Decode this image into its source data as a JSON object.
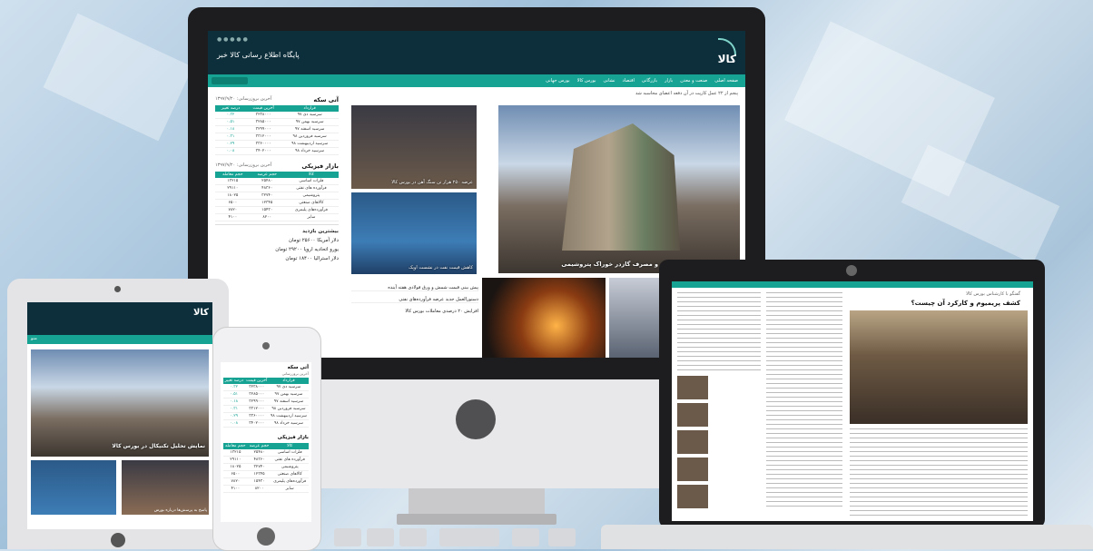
{
  "site": {
    "title": "پایگاه اطلاع رسانی کالا خبر",
    "logo_text": "کالا",
    "accent": "#16a394",
    "header_bg": "#0c2f3b"
  },
  "nav": {
    "items": [
      "صفحه اصلی",
      "صنعت و معدن",
      "بازار",
      "بازرگانی",
      "اقتصاد",
      "نشانی",
      "بورس کالا",
      "بورس جهانی"
    ]
  },
  "breadcrumb": "پنجم از ۲۲ عمل کارپت در آن دفعه اعضای محاسبه شد",
  "market_fe": {
    "title": "آتی سکه",
    "subtitle": "آخرین بروزرسانی: ۱۳۹۷/۹/۲۰",
    "headers": [
      "قرارداد",
      "آخرین قیمت",
      "درصد تغییر"
    ],
    "rows": [
      [
        "سرسید دی ۹۷",
        "۳۲۳۸۰۰۰",
        "۰.۳۲"
      ],
      [
        "سرسید بهمن ۹۷",
        "۳۲۸۵۰۰۰",
        "۰.۵۱"
      ],
      [
        "سرسید اسفند ۹۷",
        "۳۲۹۹۰۰۰",
        "۰.۱۸"
      ],
      [
        "سرسید فروردین ۹۸",
        "۳۳۱۲۰۰۰",
        "۰.۳۱"
      ],
      [
        "سرسید اردیبهشت ۹۸",
        "۳۳۶۰۰۰۰",
        "۰.۲۹"
      ],
      [
        "سرسید خرداد ۹۸",
        "۳۴۰۲۰۰۰",
        "۰.۰۸"
      ]
    ]
  },
  "market_phys": {
    "title": "بازار فیزیکی",
    "subtitle": "آخرین بروزرسانی: ۱۳۹۷/۹/۲۰",
    "headers": [
      "کالا",
      "حجم عرضه",
      "حجم معامله"
    ],
    "rows": [
      [
        "فلزات اساسی",
        "۲۵۴۸۰",
        "۱۳۲۱۵"
      ],
      [
        "فرآورده های نفتی",
        "۴۸۳۶۰",
        "۲۹۱۱۰"
      ],
      [
        "پتروشیمی",
        "۳۲۷۴۰",
        "۱۸۰۲۵"
      ],
      [
        "کالاهای صنعتی",
        "۱۲۳۴۵",
        "۶۵۰۰"
      ],
      [
        "فرآورده‌های پلیمری",
        "۱۵۴۳۰",
        "۷۸۲۰"
      ],
      [
        "سایر",
        "۸۲۰۰",
        "۴۱۰۰"
      ]
    ]
  },
  "ticker": {
    "title": "بیشترین بازدید",
    "items": [
      "دلار آمریکا ۲۵۶۰۰ تومان",
      "یورو اتحادیه اروپا ۲۹۲۰۰ تومان",
      "دلار استرالیا ۱۸۴۰۰ تومان"
    ]
  },
  "hero": {
    "caption": "افزایش ظرفیت پالایشگاه و مصرف گازدر خوراک پتروشیمی"
  },
  "thumbs": {
    "t1": "عرضه ۲۵۰ هزار تن سنگ آهن در بورس کالا",
    "t2": "کاهش قیمت نفت در نشست اوپک"
  },
  "news_list": [
    "پیش بینی قیمت شمش و ورق فولادی هفته آینده",
    "دستورالعمل جدید عرضه فرآورده‌های نفتی",
    "افزایش ۲۰ درصدی معاملات بورس کالا"
  ],
  "laptop": {
    "headline": "کشف پریمیوم و کارکرد آن چیست؟",
    "kicker": "گفتگو با کارشناس بورس کالا"
  },
  "tablet": {
    "nav_btn": "منو",
    "hero_caption": "نمایش تحلیل تکنیکال در بورس کالا",
    "sub_caption": "پاسخ به پرسش‌ها درباره بورس"
  },
  "phone": {
    "title": "آتی سکه",
    "subtitle": "آخرین بروزرسانی"
  }
}
